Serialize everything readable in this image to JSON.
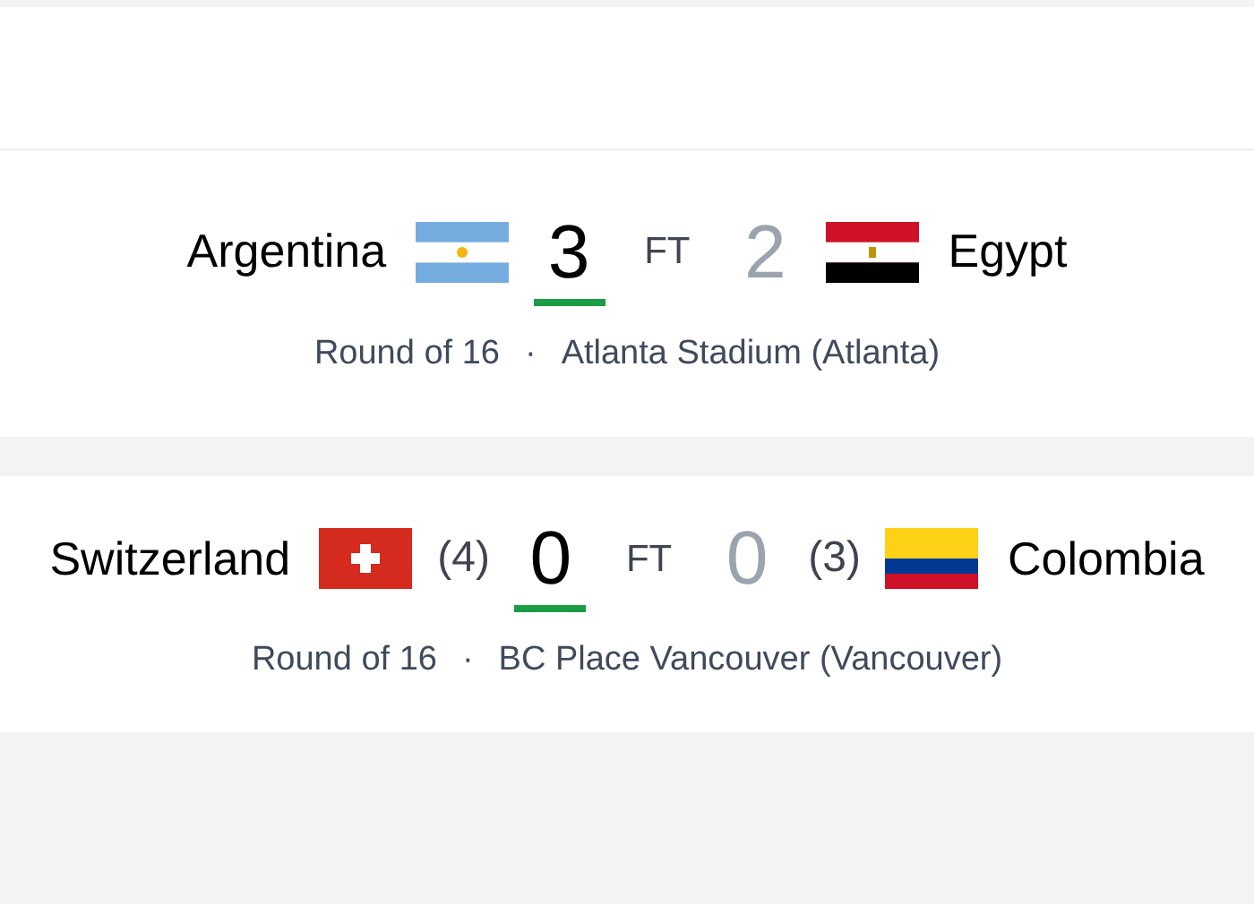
{
  "matches": [
    {
      "home": {
        "name": "Argentina",
        "kind": "ar",
        "score": "3",
        "winner": true
      },
      "status": "FT",
      "away": {
        "name": "Egypt",
        "kind": "eg",
        "score": "2",
        "winner": false
      },
      "round": "Round of 16",
      "separator": "·",
      "venue": "Atlanta Stadium (Atlanta)"
    },
    {
      "home": {
        "name": "Switzerland",
        "kind": "ch",
        "penalties": "(4)",
        "score": "0",
        "winner": true
      },
      "status": "FT",
      "away": {
        "name": "Colombia",
        "kind": "co",
        "penalties": "(3)",
        "score": "0",
        "winner": false
      },
      "round": "Round of 16",
      "separator": "·",
      "venue": "BC Place Vancouver (Vancouver)"
    }
  ]
}
